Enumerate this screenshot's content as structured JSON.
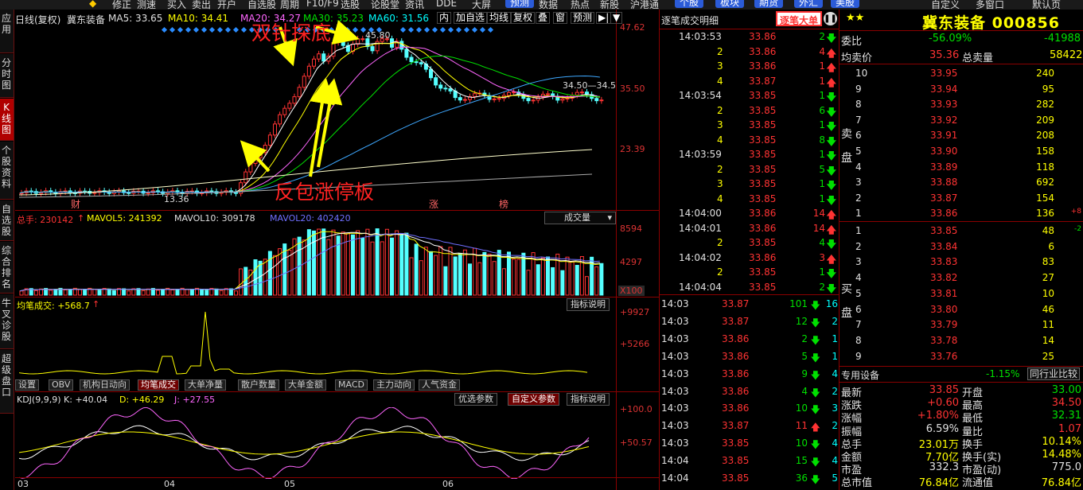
{
  "toolbar": {
    "items": [
      "修正",
      "测速",
      "买入",
      "卖出",
      "开户",
      "自选股",
      "周期",
      "F10/F9",
      "选股",
      "论股堂",
      "资讯",
      "DDE",
      "大屏",
      "预测",
      "数据",
      "热点",
      "新股",
      "沪港通",
      "个股",
      "板块",
      "期货",
      "外汇",
      "美股",
      "自定义",
      "多窗口",
      "默认页"
    ]
  },
  "sidebar": {
    "tabs": [
      "应用",
      "分时图",
      "K线图",
      "个股资料",
      "自选股",
      "综合排名",
      "牛叉诊股",
      "超级盘口"
    ],
    "active_index": 2
  },
  "chart_header": {
    "period_label": "日线(复权)",
    "stock_name": "冀东装备",
    "ma5": "MA5: 33.65",
    "ma10": "MA10: 34.41",
    "ma20": "MA20: 34.27",
    "ma30": "MA30: 35.23",
    "ma60": "MA60: 31.56",
    "buttons": [
      "内",
      "加自选",
      "均线",
      "复权",
      "叠",
      "窗",
      "预测",
      "▶|",
      "▼"
    ]
  },
  "kline": {
    "y_axis": [
      "47.62",
      "35.50",
      "23.39"
    ],
    "price_high_label": "45.80",
    "price_low_label": "13.36",
    "right_label": "34.50—34.5",
    "annotation_top": "双针探底",
    "annotation_bottom": "反包涨停板",
    "markers": [
      "财",
      "涨",
      "榜"
    ]
  },
  "volume": {
    "legend_total": "总手: 230142",
    "legend_mavol5": "MAVOL5: 241392",
    "legend_mavol10": "MAVOL10: 309178",
    "legend_mavol20": "MAVOL20: 402420",
    "dropdown": "成交量",
    "y_axis": [
      "8594",
      "4297"
    ],
    "unit": "X100"
  },
  "average_trade": {
    "legend": "均笔成交: +568.7",
    "button": "指标说明",
    "y_axis": [
      "+9927",
      "+5266"
    ]
  },
  "indicator_tabs": {
    "tabs": [
      "设置",
      "OBV",
      "机构日动向",
      "均笔成交",
      "大单净量",
      "散户数量",
      "大单金额",
      "MACD",
      "主力动向",
      "人气资金"
    ],
    "active_index": 3
  },
  "kdj": {
    "legend_main": "KDJ(9,9,9) K: +40.04",
    "legend_d": "D: +46.29",
    "legend_j": "J: +27.55",
    "buttons": [
      "优选参数",
      "自定义参数",
      "指标说明"
    ],
    "y_axis": [
      "+100.0",
      "+50.57"
    ],
    "x_axis": [
      "03",
      "04",
      "05",
      "06"
    ]
  },
  "ticks": {
    "title": "逐笔成交明细",
    "mode_button": "逐笔大单",
    "rows": [
      {
        "time": "14:03:53",
        "price": "33.86",
        "vol": "2",
        "dir": "down",
        "time_style": "white"
      },
      {
        "time": "2",
        "price": "33.86",
        "vol": "4",
        "dir": "up",
        "time_style": "yellow"
      },
      {
        "time": "3",
        "price": "33.86",
        "vol": "1",
        "dir": "up",
        "time_style": "yellow"
      },
      {
        "time": "4",
        "price": "33.87",
        "vol": "1",
        "dir": "up",
        "time_style": "yellow"
      },
      {
        "time": "14:03:54",
        "price": "33.85",
        "vol": "1",
        "dir": "down",
        "time_style": "white"
      },
      {
        "time": "2",
        "price": "33.85",
        "vol": "6",
        "dir": "down",
        "time_style": "yellow"
      },
      {
        "time": "3",
        "price": "33.85",
        "vol": "1",
        "dir": "down",
        "time_style": "yellow"
      },
      {
        "time": "4",
        "price": "33.85",
        "vol": "8",
        "dir": "down",
        "time_style": "yellow"
      },
      {
        "time": "14:03:59",
        "price": "33.85",
        "vol": "1",
        "dir": "down",
        "time_style": "white"
      },
      {
        "time": "2",
        "price": "33.85",
        "vol": "5",
        "dir": "down",
        "time_style": "yellow"
      },
      {
        "time": "3",
        "price": "33.85",
        "vol": "1",
        "dir": "down",
        "time_style": "yellow"
      },
      {
        "time": "4",
        "price": "33.85",
        "vol": "1",
        "dir": "down",
        "time_style": "yellow"
      },
      {
        "time": "14:04:00",
        "price": "33.86",
        "vol": "14",
        "dir": "up",
        "time_style": "white"
      },
      {
        "time": "14:04:01",
        "price": "33.86",
        "vol": "14",
        "dir": "up",
        "time_style": "white"
      },
      {
        "time": "2",
        "price": "33.85",
        "vol": "4",
        "dir": "down",
        "time_style": "yellow"
      },
      {
        "time": "14:04:02",
        "price": "33.86",
        "vol": "3",
        "dir": "up",
        "time_style": "white"
      },
      {
        "time": "2",
        "price": "33.85",
        "vol": "1",
        "dir": "down",
        "time_style": "yellow"
      },
      {
        "time": "14:04:04",
        "price": "33.85",
        "vol": "2",
        "dir": "down",
        "time_style": "white"
      }
    ],
    "minute_rows": [
      {
        "time": "14:03",
        "price": "33.87",
        "vol": "101",
        "dir": "down",
        "n": "16"
      },
      {
        "time": "14:03",
        "price": "33.87",
        "vol": "12",
        "dir": "down",
        "n": "2"
      },
      {
        "time": "14:03",
        "price": "33.86",
        "vol": "2",
        "dir": "down",
        "n": "1"
      },
      {
        "time": "14:03",
        "price": "33.86",
        "vol": "5",
        "dir": "down",
        "n": "1"
      },
      {
        "time": "14:03",
        "price": "33.86",
        "vol": "9",
        "dir": "down",
        "n": "4"
      },
      {
        "time": "14:03",
        "price": "33.86",
        "vol": "4",
        "dir": "down",
        "n": "2"
      },
      {
        "time": "14:03",
        "price": "33.86",
        "vol": "10",
        "dir": "down",
        "n": "3"
      },
      {
        "time": "14:03",
        "price": "33.87",
        "vol": "11",
        "dir": "up",
        "n": "2"
      },
      {
        "time": "14:03",
        "price": "33.85",
        "vol": "10",
        "dir": "down",
        "n": "4"
      },
      {
        "time": "14:04",
        "price": "33.85",
        "vol": "15",
        "dir": "down",
        "n": "4"
      },
      {
        "time": "14:04",
        "price": "33.85",
        "vol": "36",
        "dir": "down",
        "n": "5"
      }
    ]
  },
  "quote": {
    "title": "冀东装备 000856",
    "weibi_label": "委比",
    "weibi_value": "-56.09%",
    "weicha_value": "-41988",
    "avg_label": "均卖价",
    "avg_value": "35.36",
    "total_sell_label": "总卖量",
    "total_sell_value": "58422",
    "sell_side_label": "卖盘",
    "buy_side_label": "买盘",
    "sell": [
      {
        "lvl": "10",
        "price": "33.95",
        "vol": "240",
        "extra": ""
      },
      {
        "lvl": "9",
        "price": "33.94",
        "vol": "95",
        "extra": ""
      },
      {
        "lvl": "8",
        "price": "33.93",
        "vol": "282",
        "extra": ""
      },
      {
        "lvl": "7",
        "price": "33.92",
        "vol": "209",
        "extra": ""
      },
      {
        "lvl": "6",
        "price": "33.91",
        "vol": "208",
        "extra": ""
      },
      {
        "lvl": "5",
        "price": "33.90",
        "vol": "158",
        "extra": ""
      },
      {
        "lvl": "4",
        "price": "33.89",
        "vol": "118",
        "extra": ""
      },
      {
        "lvl": "3",
        "price": "33.88",
        "vol": "692",
        "extra": ""
      },
      {
        "lvl": "2",
        "price": "33.87",
        "vol": "154",
        "extra": ""
      },
      {
        "lvl": "1",
        "price": "33.86",
        "vol": "136",
        "extra": "+8"
      }
    ],
    "buy": [
      {
        "lvl": "1",
        "price": "33.85",
        "vol": "48",
        "extra": "-2"
      },
      {
        "lvl": "2",
        "price": "33.84",
        "vol": "6",
        "extra": ""
      },
      {
        "lvl": "3",
        "price": "33.83",
        "vol": "83",
        "extra": ""
      },
      {
        "lvl": "4",
        "price": "33.82",
        "vol": "27",
        "extra": ""
      },
      {
        "lvl": "5",
        "price": "33.81",
        "vol": "10",
        "extra": ""
      },
      {
        "lvl": "6",
        "price": "33.80",
        "vol": "46",
        "extra": ""
      },
      {
        "lvl": "7",
        "price": "33.79",
        "vol": "11",
        "extra": ""
      },
      {
        "lvl": "8",
        "price": "33.78",
        "vol": "14",
        "extra": ""
      },
      {
        "lvl": "9",
        "price": "33.76",
        "vol": "25",
        "extra": ""
      }
    ],
    "industry_label": "专用设备",
    "industry_change": "-1.15%",
    "compare_button": "同行业比较",
    "stats": [
      {
        "l1": "最新",
        "v1": "33.85",
        "c1": "red",
        "l2": "开盘",
        "v2": "33.00",
        "c2": "green"
      },
      {
        "l1": "涨跌",
        "v1": "+0.60",
        "c1": "red",
        "l2": "最高",
        "v2": "34.50",
        "c2": "red"
      },
      {
        "l1": "涨幅",
        "v1": "+1.80%",
        "c1": "red",
        "l2": "最低",
        "v2": "32.31",
        "c2": "green"
      },
      {
        "l1": "振幅",
        "v1": "6.59%",
        "c1": "white",
        "l2": "量比",
        "v2": "1.07",
        "c2": "red"
      },
      {
        "l1": "总手",
        "v1": "23.01万",
        "c1": "yellow",
        "l2": "换手",
        "v2": "10.14%",
        "c2": "yellow"
      },
      {
        "l1": "金额",
        "v1": "7.70亿",
        "c1": "yellow",
        "l2": "换手(实)",
        "v2": "14.48%",
        "c2": "yellow"
      },
      {
        "l1": "市盈",
        "v1": "332.3",
        "c1": "white",
        "l2": "市盈(动)",
        "v2": "775.0",
        "c2": "white"
      },
      {
        "l1": "总市值",
        "v1": "76.84亿",
        "c1": "yellow",
        "l2": "流通值",
        "v2": "76.84亿",
        "c2": "yellow"
      }
    ]
  },
  "colors": {
    "up": "#ff3333",
    "down": "#00e000",
    "bg": "#000000",
    "grid": "#8a0000",
    "yellow": "#ffff00",
    "cyan": "#54ffff"
  }
}
